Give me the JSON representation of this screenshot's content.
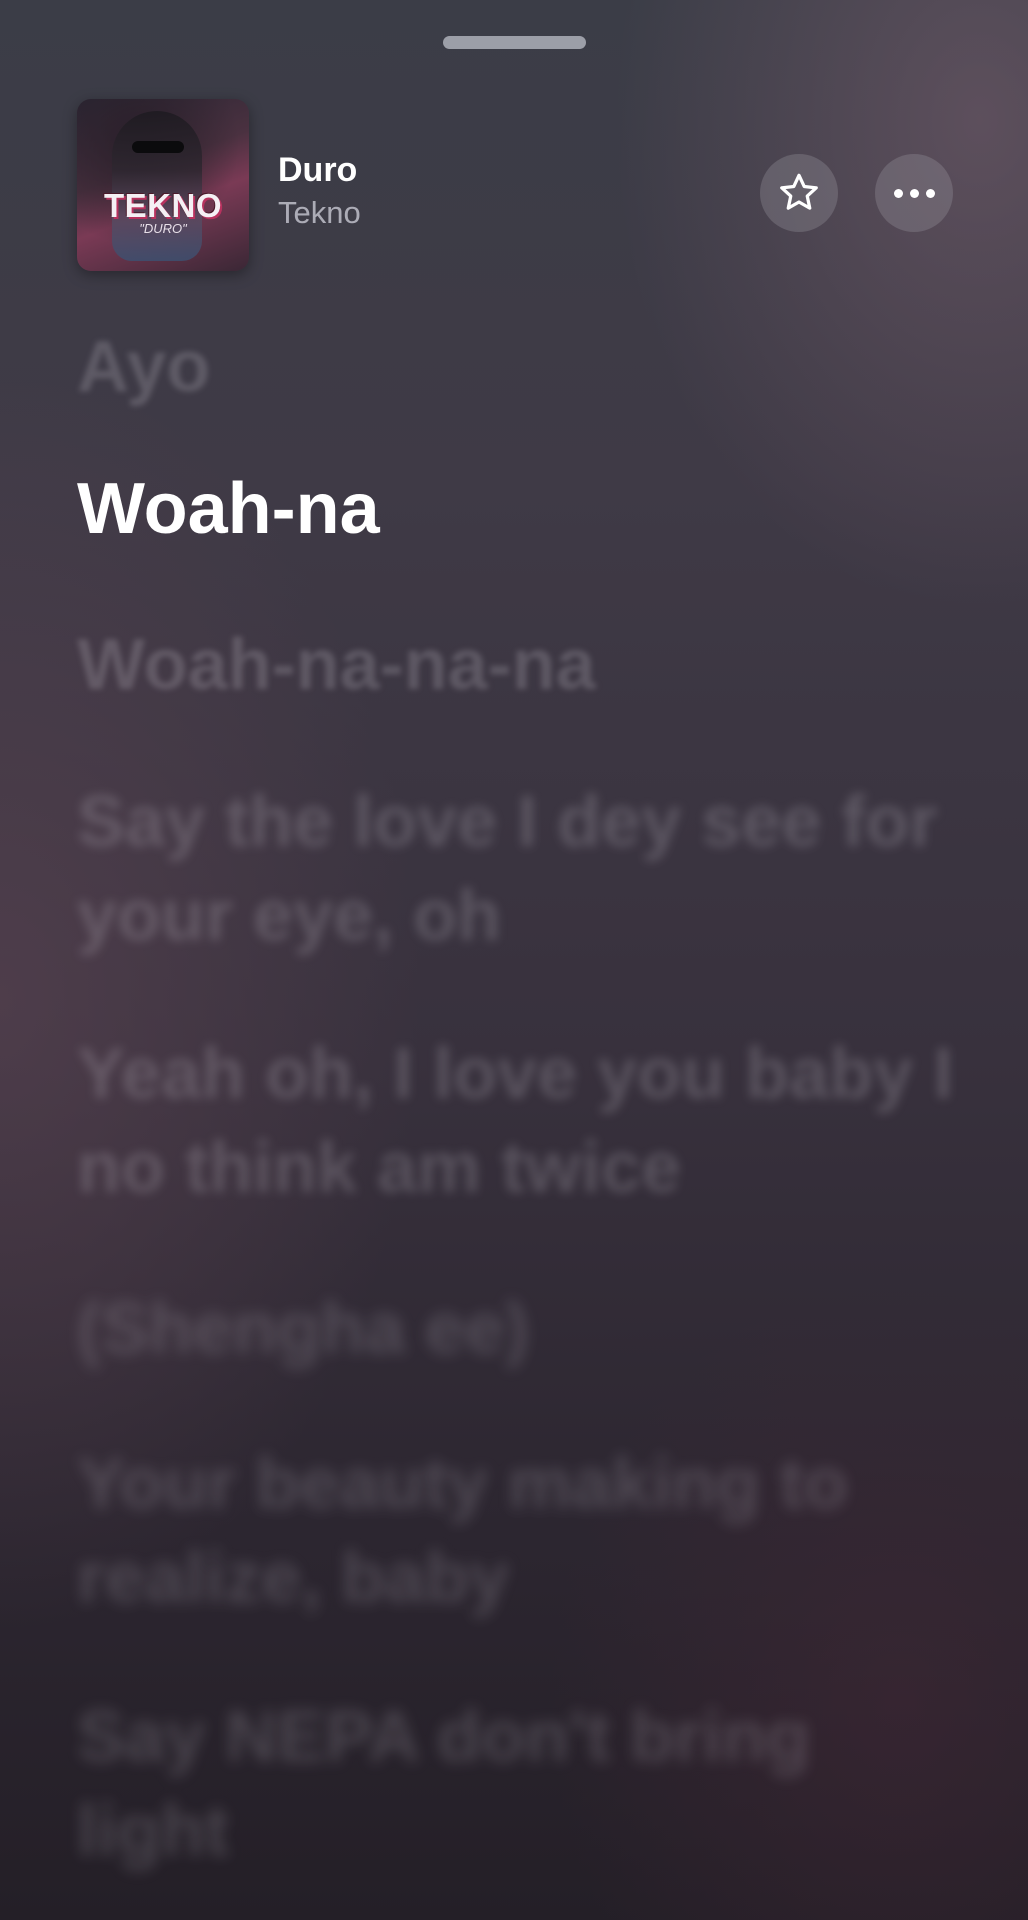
{
  "header": {
    "song_title": "Duro",
    "artist": "Tekno",
    "artwork": {
      "title_text": "TEKNO",
      "subtitle_text": "\"DURO\""
    },
    "favorite_icon": "star-outline-icon",
    "more_icon": "ellipsis-icon"
  },
  "lyrics": {
    "lines": [
      "Ayo",
      "Woah-na",
      "Woah-na-na-na",
      "Say the love I dey see for your eye, oh",
      "Yeah oh, I love you baby I no think am twice",
      "(Shengha ee)",
      "Your beauty making to realize, baby",
      "Say NEPA don't bring light"
    ],
    "active_index": 1
  },
  "colors": {
    "active_lyric": "#ffffff",
    "inactive_lyric": "rgba(210,205,215,0.28)"
  }
}
